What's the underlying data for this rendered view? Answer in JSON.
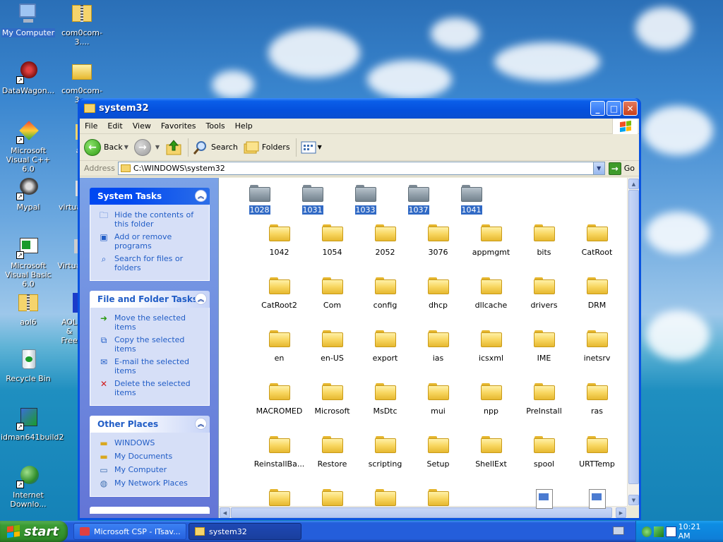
{
  "desktop": {
    "icons": [
      {
        "label": "My Computer",
        "selected": true
      },
      {
        "label": "com0com-3...."
      },
      {
        "label": "DataWagon..."
      },
      {
        "label": "com0com-3...."
      },
      {
        "label": "Microsoft Visual C++ 6.0"
      },
      {
        "label": "a"
      },
      {
        "label": "Mypal"
      },
      {
        "label": "virtua"
      },
      {
        "label": "Microsoft Visual Basic 6.0"
      },
      {
        "label": "Virtua"
      },
      {
        "label": "aol6"
      },
      {
        "label": "AOL & Free"
      },
      {
        "label": "Recycle Bin"
      },
      {
        "label": "idman641build2"
      },
      {
        "label": "Internet Downlo..."
      }
    ]
  },
  "window": {
    "title": "system32",
    "controls": {
      "minimize": "_",
      "maximize": "□",
      "close": "✕"
    },
    "menu": [
      "File",
      "Edit",
      "View",
      "Favorites",
      "Tools",
      "Help"
    ],
    "toolbar": {
      "back": "Back",
      "search": "Search",
      "folders": "Folders"
    },
    "address": {
      "label": "Address",
      "value": "C:\\WINDOWS\\system32",
      "go": "Go"
    }
  },
  "taskpane": {
    "system_tasks": {
      "title": "System Tasks",
      "items": [
        "Hide the contents of this folder",
        "Add or remove programs",
        "Search for files or folders"
      ]
    },
    "file_folder_tasks": {
      "title": "File and Folder Tasks",
      "items": [
        "Move the selected items",
        "Copy the selected items",
        "E-mail the selected items",
        "Delete the selected items"
      ]
    },
    "other_places": {
      "title": "Other Places",
      "items": [
        "WINDOWS",
        "My Documents",
        "My Computer",
        "My Network Places"
      ]
    }
  },
  "files": {
    "selected": [
      "1028",
      "1031",
      "1033",
      "1037",
      "1041"
    ],
    "rows": [
      [
        "1042",
        "1054",
        "2052",
        "3076",
        "appmgmt",
        "bits",
        "CatRoot"
      ],
      [
        "CatRoot2",
        "Com",
        "config",
        "dhcp",
        "dllcache",
        "drivers",
        "DRM"
      ],
      [
        "en",
        "en-US",
        "export",
        "ias",
        "icsxml",
        "IME",
        "inetsrv"
      ],
      [
        "MACROMED",
        "Microsoft",
        "MsDtc",
        "mui",
        "npp",
        "PreInstall",
        "ras"
      ],
      [
        "ReinstallBa...",
        "Restore",
        "scripting",
        "Setup",
        "ShellExt",
        "spool",
        "URTTemp"
      ]
    ]
  },
  "taskbar": {
    "start": "start",
    "items": [
      "Microsoft CSP - ITsav...",
      "system32"
    ],
    "clock": "10:21 AM"
  },
  "colors": {
    "xp_blue": "#0a53e0",
    "selection": "#316ac5",
    "task_link": "#215dc6",
    "start_green": "#3c9c35"
  }
}
